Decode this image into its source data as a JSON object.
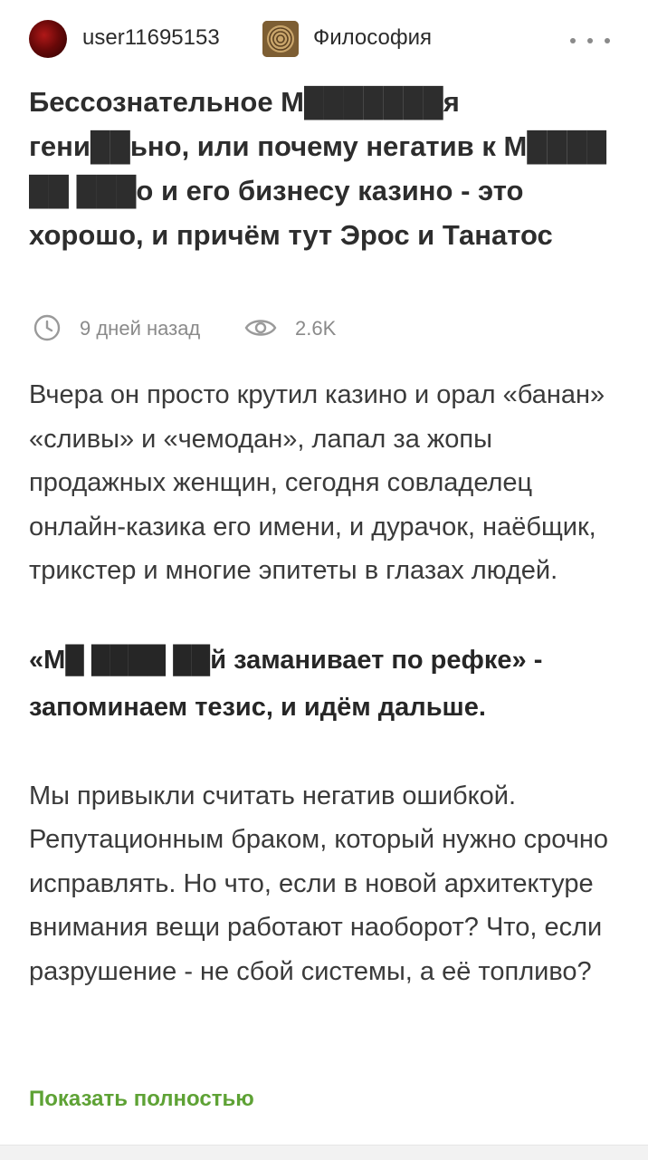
{
  "header": {
    "username": "user11695153",
    "community": "Философия",
    "more_icon": "more-horizontal-icon"
  },
  "post": {
    "title": "Бессознательное М███████я гени██ьно, или почему негатив к М████ ██ ███о и его бизнесу казино - это хорошо, и причём тут Эрос и Танатос",
    "time_ago": "9 дней назад",
    "views": "2.6K",
    "paragraphs": [
      "Вчера он просто крутил казино и орал «банан» «сливы» и «чемодан», лапал за жопы продажных женщин, сегодня совладелец онлайн-казика его имени, и дурачок, наёбщик, трикстер и многие эпитеты в глазах людей.",
      "«М█ ████ ██й заманивает по рефке» - запоминаем тезис, и идём дальше.",
      "Мы привыкли считать негатив ошибкой. Репутационным браком, который нужно срочно исправлять. Но что, если в новой архитектуре внимания вещи работают наоборот? Что, если разрушение - не сбой системы, а её топливо?"
    ],
    "show_more": "Показать полностью"
  },
  "colors": {
    "accent_green": "#5ea235",
    "meta_gray": "#8a8a8a",
    "text": "#3a3a3a"
  }
}
